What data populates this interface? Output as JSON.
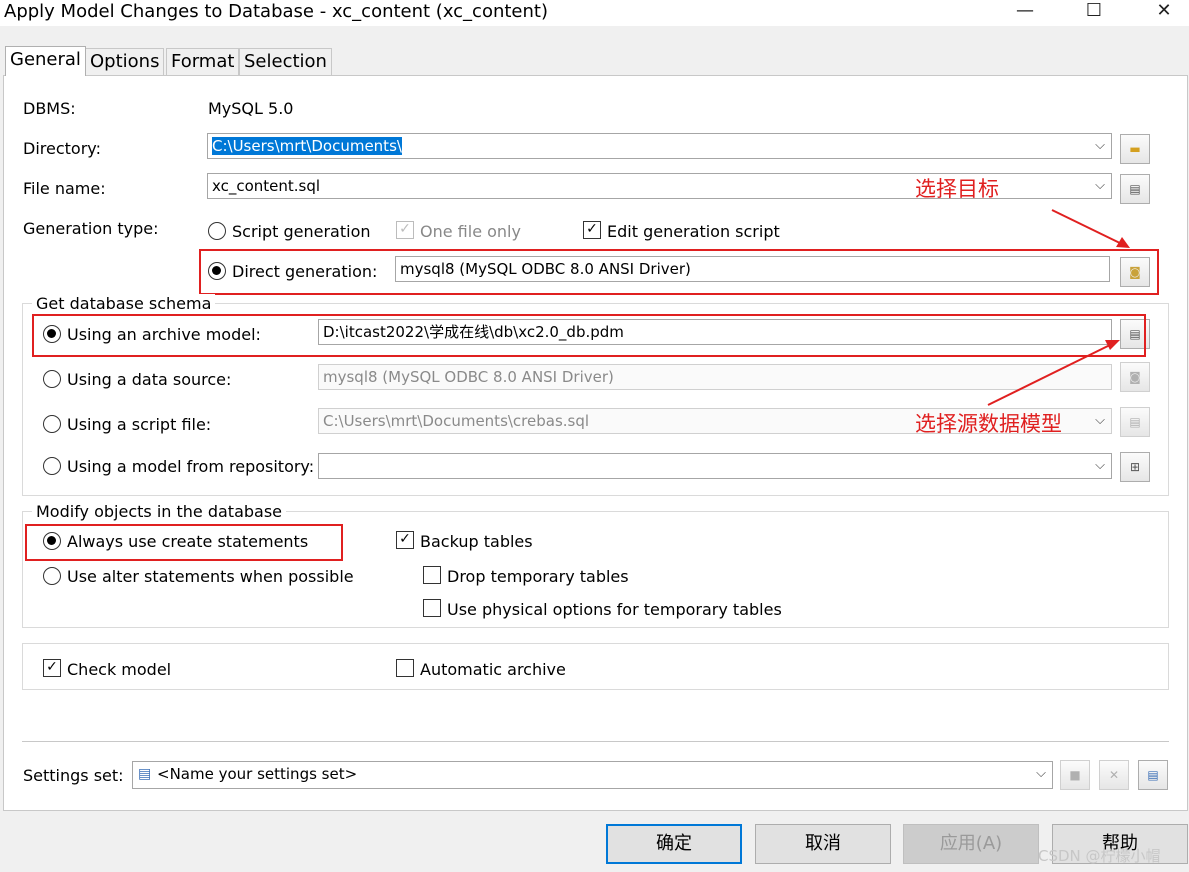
{
  "window": {
    "title": "Apply Model Changes to Database - xc_content (xc_content)",
    "minimize": "—",
    "maximize": "☐",
    "close": "✕"
  },
  "tabs": [
    {
      "label": "General",
      "active": true
    },
    {
      "label": "Options",
      "active": false
    },
    {
      "label": "Format",
      "active": false
    },
    {
      "label": "Selection",
      "active": false
    }
  ],
  "general": {
    "dbms_label": "DBMS:",
    "dbms_value": "MySQL 5.0",
    "directory_label": "Directory:",
    "directory_value": "C:\\Users\\mrt\\Documents\\",
    "filename_label": "File name:",
    "filename_value": "xc_content.sql",
    "gentype_label": "Generation type:",
    "script_generation": "Script generation",
    "one_file_only": "One file only",
    "edit_generation_script": "Edit generation script",
    "direct_generation": "Direct generation:",
    "direct_source": "mysql8 (MySQL ODBC 8.0 ANSI Driver)"
  },
  "schema": {
    "title": "Get database schema",
    "archive_label": "Using an archive model:",
    "archive_value": "D:\\itcast2022\\学成在线\\db\\xc2.0_db.pdm",
    "datasource_label": "Using a data source:",
    "datasource_value": "mysql8 (MySQL ODBC 8.0 ANSI Driver)",
    "scriptfile_label": "Using a script file:",
    "scriptfile_value": "C:\\Users\\mrt\\Documents\\crebas.sql",
    "repository_label": "Using a model from repository:",
    "repository_value": ""
  },
  "modify": {
    "title": "Modify objects in the database",
    "always_create": "Always use create statements",
    "use_alter": "Use alter statements when possible",
    "backup_tables": "Backup tables",
    "drop_temp": "Drop temporary tables",
    "physical_opts": "Use physical options for temporary tables"
  },
  "check_model": "Check model",
  "automatic_archive": "Automatic archive",
  "settings": {
    "label": "Settings set:",
    "value": "<Name your settings set>"
  },
  "buttons": {
    "ok": "确定",
    "cancel": "取消",
    "apply": "应用(A)",
    "help": "帮助"
  },
  "annotations": {
    "select_target": "选择目标",
    "select_source": "选择源数据模型"
  },
  "watermark": "CSDN @柠檬小帽",
  "colors": {
    "annotation": "#e02020",
    "selection": "#0078d7"
  }
}
